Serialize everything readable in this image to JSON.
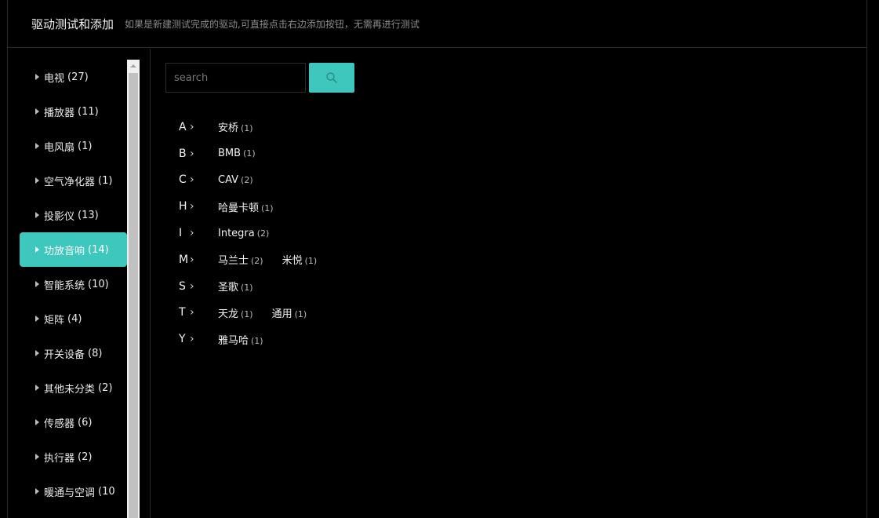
{
  "header": {
    "title": "驱动测试和添加",
    "description": "如果是新建测试完成的驱动,可直接点击右边添加按钮，无需再进行测试"
  },
  "sidebar": {
    "categories": [
      {
        "label": "电视",
        "count": "(27)",
        "active": false
      },
      {
        "label": "播放器",
        "count": "(11)",
        "active": false
      },
      {
        "label": "电风扇",
        "count": "(1)",
        "active": false
      },
      {
        "label": "空气净化器",
        "count": "(1)",
        "active": false
      },
      {
        "label": "投影仪",
        "count": "(13)",
        "active": false
      },
      {
        "label": "功放音响",
        "count": "(14)",
        "active": true
      },
      {
        "label": "智能系统",
        "count": "(10)",
        "active": false
      },
      {
        "label": "矩阵",
        "count": "(4)",
        "active": false
      },
      {
        "label": "开关设备",
        "count": "(8)",
        "active": false
      },
      {
        "label": "其他未分类",
        "count": "(2)",
        "active": false
      },
      {
        "label": "传感器",
        "count": "(6)",
        "active": false
      },
      {
        "label": "执行器",
        "count": "(2)",
        "active": false
      },
      {
        "label": "暖通与空调",
        "count": "(10",
        "active": false
      }
    ]
  },
  "search": {
    "placeholder": "search",
    "value": ""
  },
  "brand_groups": [
    {
      "letter": "A",
      "brands": [
        {
          "name": "安桥",
          "count": "(1)"
        }
      ]
    },
    {
      "letter": "B",
      "brands": [
        {
          "name": "BMB",
          "count": "(1)"
        }
      ]
    },
    {
      "letter": "C",
      "brands": [
        {
          "name": "CAV",
          "count": "(2)"
        }
      ]
    },
    {
      "letter": "H",
      "brands": [
        {
          "name": "哈曼卡顿",
          "count": "(1)"
        }
      ]
    },
    {
      "letter": "I",
      "brands": [
        {
          "name": "Integra",
          "count": "(2)"
        }
      ]
    },
    {
      "letter": "M",
      "brands": [
        {
          "name": "马兰士",
          "count": "(2)"
        },
        {
          "name": "米悦",
          "count": "(1)"
        }
      ]
    },
    {
      "letter": "S",
      "brands": [
        {
          "name": "圣歌",
          "count": "(1)"
        }
      ]
    },
    {
      "letter": "T",
      "brands": [
        {
          "name": "天龙",
          "count": "(1)"
        },
        {
          "name": "通用",
          "count": "(1)"
        }
      ]
    },
    {
      "letter": "Y",
      "brands": [
        {
          "name": "雅马哈",
          "count": "(1)"
        }
      ]
    }
  ],
  "colors": {
    "accent": "#3ec8bd",
    "background": "#000000"
  }
}
